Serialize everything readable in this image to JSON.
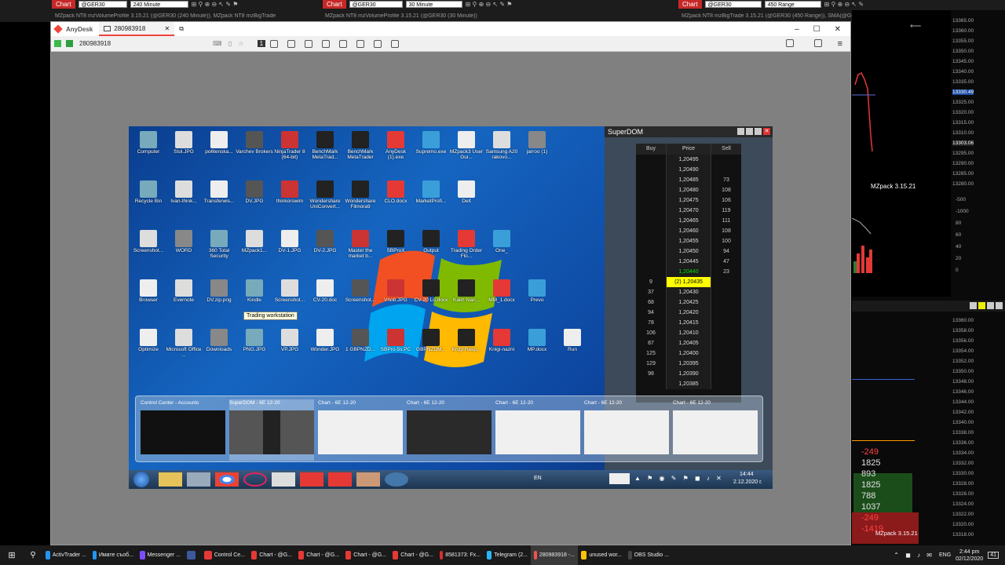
{
  "nt_top": {
    "left": {
      "chart_tag": "Chart",
      "instrument": "@GER30",
      "period": "240 Minute",
      "subtitle": "MZpack NT8 mzVolumeProfile 3.15.21 (@GER30 (240 Minute)), MZpack NT8 mzBigTrade"
    },
    "mid": {
      "chart_tag": "Chart",
      "instrument": "@GER30",
      "period": "30 Minute",
      "subtitle": "MZpack NT8 mzVolumeProfile 3.15.21 (@GER30 (30 Minute))"
    },
    "right": {
      "chart_tag": "Chart",
      "instrument": "@GER30",
      "period": "450 Range",
      "subtitle": "MZpack NT8 mzBigTrade 3.15.21 (@GER30 (450 Range)), SMA(@GER30 (450 Range),50)"
    }
  },
  "anydesk": {
    "app_name": "AnyDesk",
    "tab_label": "280983918",
    "address": "280983918",
    "badge": "1"
  },
  "desktop_icons": [
    {
      "label": "Computer"
    },
    {
      "label": "Stol.JPG"
    },
    {
      "label": "po6tenska..."
    },
    {
      "label": "Varchev Brokers"
    },
    {
      "label": "NinjaTrader 8 (64-bit)"
    },
    {
      "label": "BenchMark MetaTrad..."
    },
    {
      "label": "BenchMark MetaTrader"
    },
    {
      "label": "AnyDesk (1).exe"
    },
    {
      "label": "Supremo.exe"
    },
    {
      "label": "MZpack3 User Gui..."
    },
    {
      "label": "Samsung A20 rakovo..."
    },
    {
      "label": "jarroo (1)"
    },
    {
      "label": "Recycle Bin"
    },
    {
      "label": "Ivan-think..."
    },
    {
      "label": "Transferwis..."
    },
    {
      "label": "DV.JPG"
    },
    {
      "label": "thinkorswim"
    },
    {
      "label": "Wondershare UniConvert..."
    },
    {
      "label": "Wondershare Filmora9"
    },
    {
      "label": "CLO.docx"
    },
    {
      "label": "MarketProfi..."
    },
    {
      "label": "Delt"
    },
    {
      "label": "Screenshot..."
    },
    {
      "label": "WORD"
    },
    {
      "label": "360 Total Security"
    },
    {
      "label": "MZpack1..."
    },
    {
      "label": "DV-1.JPG"
    },
    {
      "label": "DV-2.JPG"
    },
    {
      "label": "Master the market b..."
    },
    {
      "label": "SBProX"
    },
    {
      "label": "Output"
    },
    {
      "label": "Trading Order Flo..."
    },
    {
      "label": "One_"
    },
    {
      "label": "Browser"
    },
    {
      "label": "Evernote"
    },
    {
      "label": "DV.zip.png"
    },
    {
      "label": "Kindle"
    },
    {
      "label": "Screenshot..."
    },
    {
      "label": "CV-20.doc"
    },
    {
      "label": "Screenshot..."
    },
    {
      "label": "Vnob.JPG"
    },
    {
      "label": "CV-20 Lo.docx"
    },
    {
      "label": "Kalin Ivan..."
    },
    {
      "label": "MM_1.docx"
    },
    {
      "label": "Prevo"
    },
    {
      "label": "Optimize"
    },
    {
      "label": "Microsoft Office ..."
    },
    {
      "label": "Downloads"
    },
    {
      "label": "PNG.JPG"
    },
    {
      "label": "VP.JPG"
    },
    {
      "label": "Wonder.JPG"
    },
    {
      "label": "1 GBPNZD..."
    },
    {
      "label": "SBPro-5s.PC"
    },
    {
      "label": "GBPNZDM..."
    },
    {
      "label": "Knigi Rasp..."
    },
    {
      "label": "Knigi-nazni"
    },
    {
      "label": "MP.docx"
    },
    {
      "label": "Run"
    }
  ],
  "tooltip": "Trading workstation",
  "superdom": {
    "title": "SuperDOM",
    "headers": {
      "buy": "Buy",
      "price": "Price",
      "sell": "Sell"
    },
    "rows": [
      {
        "buy": "",
        "price": "1,20495",
        "sell": ""
      },
      {
        "buy": "",
        "price": "1,20490",
        "sell": ""
      },
      {
        "buy": "",
        "price": "1,20485",
        "sell": "73"
      },
      {
        "buy": "",
        "price": "1,20480",
        "sell": "108"
      },
      {
        "buy": "",
        "price": "1,20475",
        "sell": "106"
      },
      {
        "buy": "",
        "price": "1,20470",
        "sell": "119"
      },
      {
        "buy": "",
        "price": "1,20465",
        "sell": "111"
      },
      {
        "buy": "",
        "price": "1,20460",
        "sell": "108"
      },
      {
        "buy": "",
        "price": "1,20455",
        "sell": "100"
      },
      {
        "buy": "",
        "price": "1,20450",
        "sell": "94"
      },
      {
        "buy": "",
        "price": "1,20445",
        "sell": "47"
      },
      {
        "buy": "",
        "price": "1,20440",
        "sell": "23"
      },
      {
        "buy": "9",
        "price": "(2) 1,20435",
        "sell": ""
      },
      {
        "buy": "37",
        "price": "1,20430",
        "sell": ""
      },
      {
        "buy": "68",
        "price": "1,20425",
        "sell": ""
      },
      {
        "buy": "94",
        "price": "1,20420",
        "sell": ""
      },
      {
        "buy": "78",
        "price": "1,20415",
        "sell": ""
      },
      {
        "buy": "106",
        "price": "1,20410",
        "sell": ""
      },
      {
        "buy": "87",
        "price": "1,20405",
        "sell": ""
      },
      {
        "buy": "125",
        "price": "1,20400",
        "sell": ""
      },
      {
        "buy": "129",
        "price": "1,20395",
        "sell": ""
      },
      {
        "buy": "98",
        "price": "1,20390",
        "sell": ""
      },
      {
        "buy": "",
        "price": "1,20385",
        "sell": ""
      }
    ],
    "last_price_color": "#00e000",
    "current_highlight": "#ffff00"
  },
  "switcher": [
    {
      "title": "Control Center - Accounts"
    },
    {
      "title": "SuperDOM - 6E 12-20"
    },
    {
      "title": "Chart - 6E 12-20"
    },
    {
      "title": "Chart - 6E 12-20"
    },
    {
      "title": "Chart - 6E 12-20"
    },
    {
      "title": "Chart - 6E 12-20"
    },
    {
      "title": "Chart - 6E 12-20"
    }
  ],
  "remote_taskbar": {
    "lang": "EN",
    "time": "14:44",
    "date": "2.12.2020 г."
  },
  "nt_right": {
    "prices_top": [
      "13365.00",
      "13360.00",
      "13355.00",
      "13350.00",
      "13345.00",
      "13340.00",
      "13335.00",
      "13330.49",
      "13325.00",
      "13320.00",
      "13315.00",
      "13310.00",
      "13303.06",
      "13295.00",
      "13290.00",
      "13285.00",
      "13280.00"
    ],
    "label": "MZpack 3.15.21",
    "osc_ticks": [
      "-500",
      "-1000",
      "80",
      "60",
      "40",
      "20",
      "0"
    ],
    "bottom_ticks": [
      "13360.00",
      "13358.00",
      "13356.00",
      "13354.00",
      "13352.00",
      "13350.00",
      "13348.00",
      "13346.00",
      "13344.00",
      "13342.00",
      "13340.00",
      "13338.00",
      "13336.00",
      "13334.00",
      "13332.00",
      "13330.00",
      "13328.00",
      "13326.00",
      "13324.00",
      "13322.00",
      "13320.00",
      "13318.00"
    ],
    "big_numbers": [
      "-249",
      "1825",
      "893",
      "1825",
      "788",
      "1037",
      "-249",
      "-1419"
    ],
    "bottom_label": "MZpack 3.15.21"
  },
  "taskbar": {
    "apps": [
      {
        "label": "ActivTrader ...",
        "color": "#2196f3"
      },
      {
        "label": "Имате съоб...",
        "color": "#2196f3"
      },
      {
        "label": "Messenger ...",
        "color": "#7c4dff"
      },
      {
        "label": "",
        "color": "#3b5998"
      },
      {
        "label": "Control Ce...",
        "color": "#e53935"
      },
      {
        "label": "Chart - @G...",
        "color": "#e53935"
      },
      {
        "label": "Chart - @G...",
        "color": "#e53935"
      },
      {
        "label": "Chart - @G...",
        "color": "#e53935"
      },
      {
        "label": "Chart - @G...",
        "color": "#e53935"
      },
      {
        "label": "8581373: Fx...",
        "color": "#d32f2f"
      },
      {
        "label": "Telegram (2...",
        "color": "#29b6f6"
      },
      {
        "label": "280983918 -...",
        "color": "#ef5350"
      },
      {
        "label": "unused wor...",
        "color": "#ffc107"
      },
      {
        "label": "OBS Studio ...",
        "color": "#444"
      }
    ],
    "lang": "ENG",
    "time": "2:44 pm",
    "date": "02/12/2020",
    "notif": "41"
  }
}
